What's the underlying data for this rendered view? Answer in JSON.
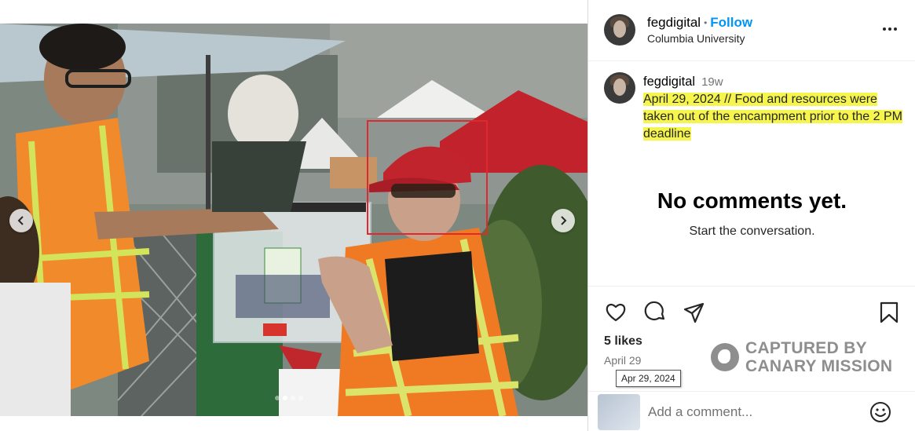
{
  "media": {
    "carousel": {
      "count": 4,
      "active": 1
    },
    "prev_label": "previous",
    "next_label": "next"
  },
  "header": {
    "username": "fegdigital",
    "separator": "•",
    "follow_label": "Follow",
    "location": "Columbia University",
    "more_icon": "more-options-icon"
  },
  "caption": {
    "username": "fegdigital",
    "time": "19w",
    "text": "April 29, 2024 // Food and resources were taken out of the encampment prior to the 2 PM deadline",
    "highlight_color": "#f5f54d"
  },
  "comments": {
    "empty_title": "No comments yet.",
    "empty_subtitle": "Start the conversation."
  },
  "actions": {
    "icons": [
      "heart-icon",
      "comment-icon",
      "share-icon",
      "bookmark-icon"
    ]
  },
  "stats": {
    "likes": "5 likes",
    "date": "April 29",
    "date_tooltip": "Apr 29, 2024"
  },
  "watermark": {
    "line1": "CAPTURED BY",
    "line2": "CANARY MISSION"
  },
  "comment_box": {
    "placeholder": "Add a comment..."
  },
  "colors": {
    "link_blue": "#0095f6",
    "annotation_red": "#e0292e",
    "muted_text": "#737373"
  }
}
